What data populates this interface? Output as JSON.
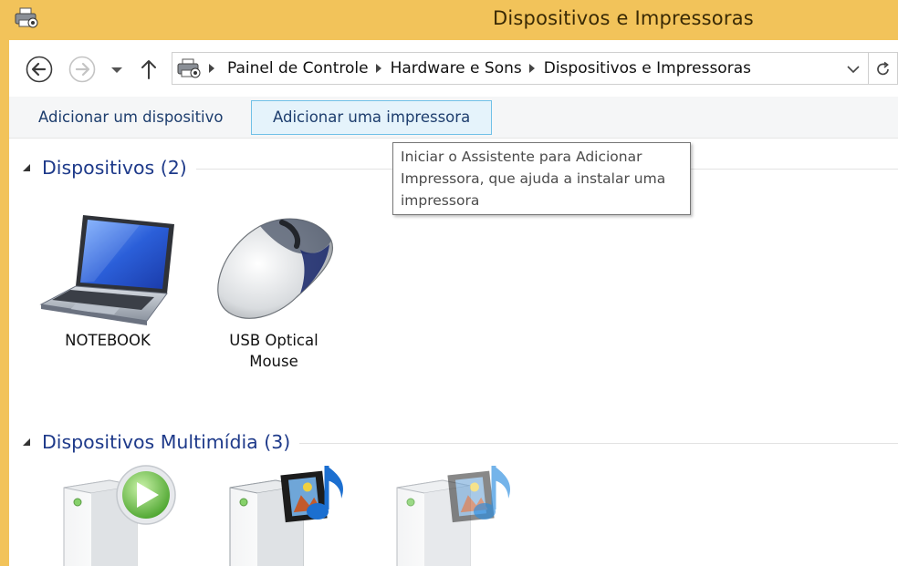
{
  "window": {
    "title": "Dispositivos e Impressoras"
  },
  "address_bar": {
    "breadcrumbs": [
      "Painel de Controle",
      "Hardware e Sons",
      "Dispositivos e Impressoras"
    ]
  },
  "command_bar": {
    "add_device_label": "Adicionar um dispositivo",
    "add_printer_label": "Adicionar uma impressora"
  },
  "tooltip": {
    "text": "Iniciar o Assistente para Adicionar Impressora, que ajuda a instalar uma impressora"
  },
  "groups": {
    "devices": {
      "title": "Dispositivos (2)",
      "items": [
        {
          "label": "NOTEBOOK",
          "icon": "laptop-icon"
        },
        {
          "label": "USB Optical Mouse",
          "icon": "mouse-icon"
        }
      ]
    },
    "multimedia": {
      "title": "Dispositivos Multimídia (3)",
      "items": [
        {
          "icon": "media-server-play-icon"
        },
        {
          "icon": "media-server-film-music-icon"
        },
        {
          "icon": "media-server-film-music-icon"
        }
      ]
    }
  },
  "colors": {
    "title_bar": "#f2c35a",
    "group_title": "#1e3a8a",
    "command_text": "#1e3e6e",
    "hover_bg": "#e5f3fb",
    "hover_border": "#70c0e7"
  }
}
